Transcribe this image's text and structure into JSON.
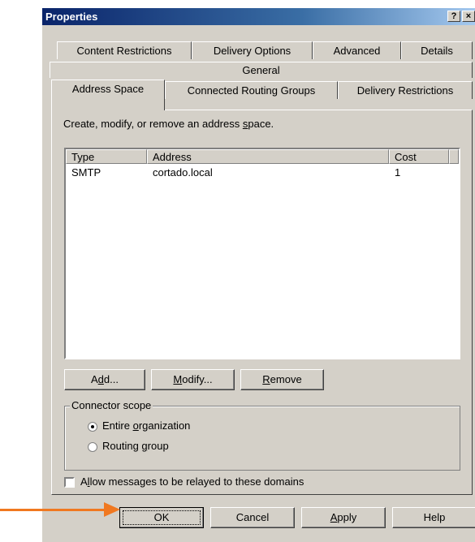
{
  "window": {
    "title": "Properties",
    "help_button": "?",
    "close_button": "×"
  },
  "tabs": {
    "row1": [
      "Content Restrictions",
      "Delivery Options",
      "Advanced",
      "Details"
    ],
    "row2": [
      "General"
    ],
    "row3": [
      "Address Space",
      "Connected Routing Groups",
      "Delivery Restrictions"
    ],
    "active": "Address Space"
  },
  "panel": {
    "instruction_pre": "Create, modify, or remove an address ",
    "instruction_u": "s",
    "instruction_post": "pace."
  },
  "list": {
    "columns": [
      "Type",
      "Address",
      "Cost"
    ],
    "rows": [
      {
        "type": "SMTP",
        "address": "cortado.local",
        "cost": "1"
      }
    ]
  },
  "buttons": {
    "add_pre": "A",
    "add_u": "d",
    "add_post": "d...",
    "modify_u": "M",
    "modify_post": "odify...",
    "remove_u": "R",
    "remove_post": "emove"
  },
  "scope": {
    "legend": "Connector scope",
    "entire_pre": "Entire ",
    "entire_u": "o",
    "entire_post": "rganization",
    "routing_pre": "Routing ",
    "routing_u": "g",
    "routing_post": "roup",
    "selected": "entire_organization"
  },
  "relay": {
    "label_pre": "A",
    "label_u": "l",
    "label_post": "low messages to be relayed to these domains",
    "checked": false
  },
  "dialog_buttons": {
    "ok": "OK",
    "cancel": "Cancel",
    "apply_u": "A",
    "apply_post": "pply",
    "help": "Help"
  },
  "annotation": {
    "arrow_color": "#f07820"
  }
}
